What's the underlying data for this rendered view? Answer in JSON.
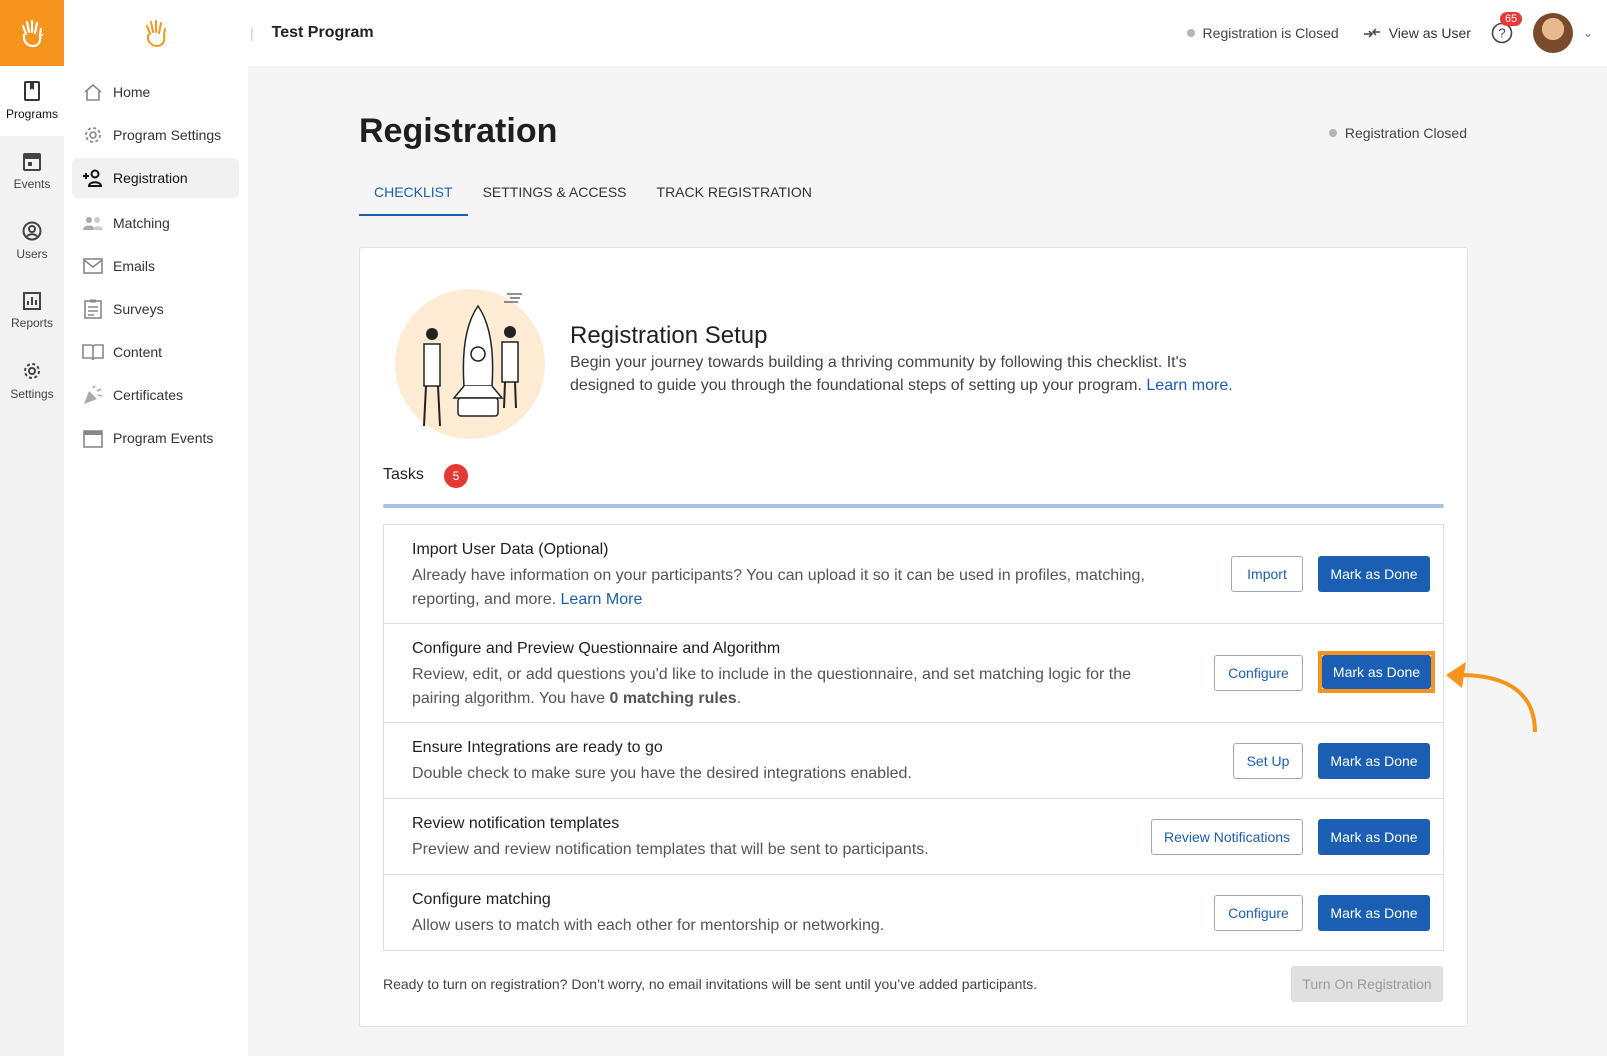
{
  "rail": {
    "items": [
      {
        "label": "Programs",
        "icon": "book-icon"
      },
      {
        "label": "Events",
        "icon": "calendar-icon"
      },
      {
        "label": "Users",
        "icon": "user-circle-icon"
      },
      {
        "label": "Reports",
        "icon": "bar-chart-icon"
      },
      {
        "label": "Settings",
        "icon": "gear-icon"
      }
    ]
  },
  "sidebar": {
    "items": [
      {
        "label": "Home",
        "icon": "home-icon"
      },
      {
        "label": "Program Settings",
        "icon": "gear-icon"
      },
      {
        "label": "Registration",
        "icon": "add-user-icon"
      },
      {
        "label": "Matching",
        "icon": "people-icon"
      },
      {
        "label": "Emails",
        "icon": "envelope-icon"
      },
      {
        "label": "Surveys",
        "icon": "clipboard-icon"
      },
      {
        "label": "Content",
        "icon": "open-book-icon"
      },
      {
        "label": "Certificates",
        "icon": "party-popper-icon"
      },
      {
        "label": "Program Events",
        "icon": "calendar-icon"
      }
    ]
  },
  "topbar": {
    "program_name": "Test Program",
    "registration_status": "Registration is Closed",
    "view_as_user": "View as User",
    "help_badge": "65"
  },
  "page": {
    "title": "Registration",
    "status": "Registration Closed",
    "tabs": [
      "CHECKLIST",
      "SETTINGS & ACCESS",
      "TRACK REGISTRATION"
    ]
  },
  "setup": {
    "title": "Registration Setup",
    "desc": "Begin your journey towards building a thriving community by following this checklist. It's designed to guide you through the foundational steps of setting up your program.",
    "learn_more": "Learn more."
  },
  "tasks": {
    "label": "Tasks",
    "count": "5",
    "items": [
      {
        "title": "Import User Data (Optional)",
        "desc": "Already have information on your participants? You can upload it so it can be used in profiles, matching, reporting, and more.",
        "link": "Learn More",
        "action": "Import",
        "done": "Mark as Done"
      },
      {
        "title": "Configure and Preview Questionnaire and Algorithm",
        "desc": "Review, edit, or add questions you'd like to include in the questionnaire, and set matching logic for the pairing algorithm. You have",
        "bold": "0 matching rules",
        "tail": ".",
        "action": "Configure",
        "done": "Mark as Done"
      },
      {
        "title": "Ensure Integrations are ready to go",
        "desc": "Double check to make sure you have the desired integrations enabled.",
        "action": "Set Up",
        "done": "Mark as Done"
      },
      {
        "title": "Review notification templates",
        "desc": "Preview and review notification templates that will be sent to participants.",
        "action": "Review Notifications",
        "done": "Mark as Done"
      },
      {
        "title": "Configure matching",
        "desc": "Allow users to match with each other for mentorship or networking.",
        "action": "Configure",
        "done": "Mark as Done"
      }
    ]
  },
  "footer": {
    "note": "Ready to turn on registration? Don’t worry, no email invitations will be sent until you’ve added participants.",
    "button": "Turn On Registration"
  },
  "colors": {
    "accent": "#f7941d",
    "primary": "#1a5fb4",
    "badge": "#e53935"
  }
}
